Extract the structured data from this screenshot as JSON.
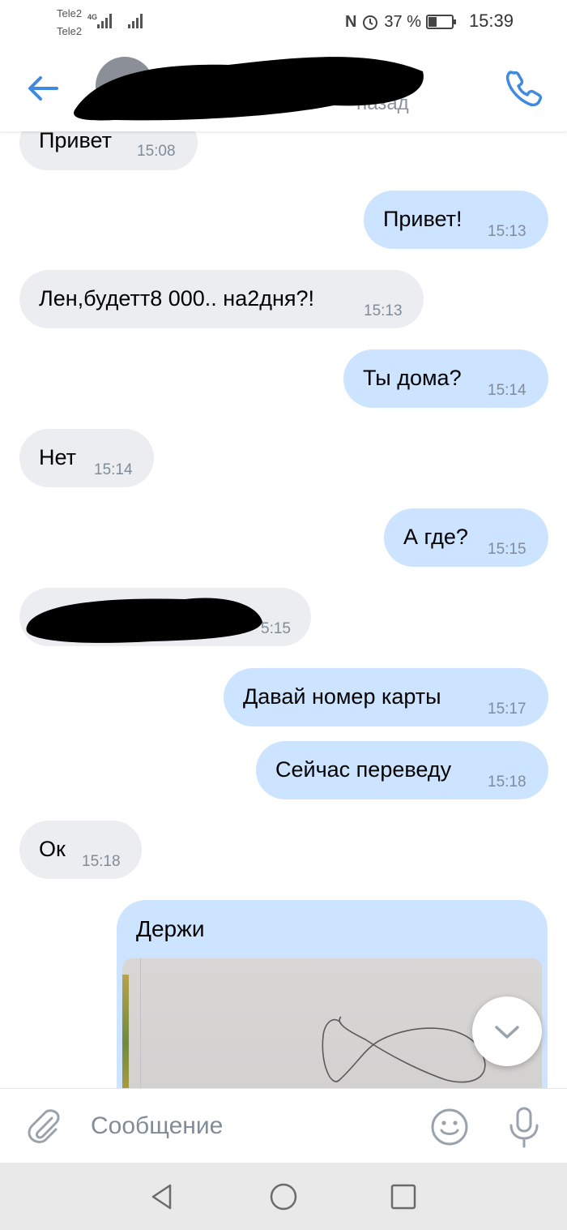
{
  "status_bar": {
    "carrier1": "Tele2",
    "carrier2": "Tele2",
    "network": "4G",
    "battery_text": "37 %",
    "battery_level": 0.37,
    "time": "15:39"
  },
  "header": {
    "status_text": "назад"
  },
  "messages": [
    {
      "dir": "in",
      "text": "Привет",
      "time": "15:08"
    },
    {
      "dir": "out",
      "text": "Привет!",
      "time": "15:13"
    },
    {
      "dir": "in",
      "text": "Лен,будетт8 000.. на2дня?!",
      "time": "15:13"
    },
    {
      "dir": "out",
      "text": "Ты дома?",
      "time": "15:14"
    },
    {
      "dir": "in",
      "text": "Нет",
      "time": "15:14"
    },
    {
      "dir": "out",
      "text": "А где?",
      "time": "15:15"
    },
    {
      "dir": "in",
      "text": "",
      "time": "5:15"
    },
    {
      "dir": "out",
      "text": "Давай номер карты",
      "time": "15:17"
    },
    {
      "dir": "out",
      "text": "Сейчас переведу",
      "time": "15:18"
    },
    {
      "dir": "in",
      "text": "Ок",
      "time": "15:18"
    }
  ],
  "photo_message": {
    "caption": "Держи"
  },
  "composer": {
    "placeholder": "Сообщение"
  },
  "icons": {
    "back": "arrow-left-icon",
    "call": "phone-icon",
    "attach": "paperclip-icon",
    "emoji": "smile-icon",
    "mic": "microphone-icon",
    "scroll": "chevron-down-icon"
  },
  "colors": {
    "accent": "#3f8ae0",
    "incoming_bubble": "#ebedf0",
    "outgoing_bubble": "#cce4ff",
    "secondary_text": "#818c99",
    "navbar": "#e9e9ea"
  }
}
